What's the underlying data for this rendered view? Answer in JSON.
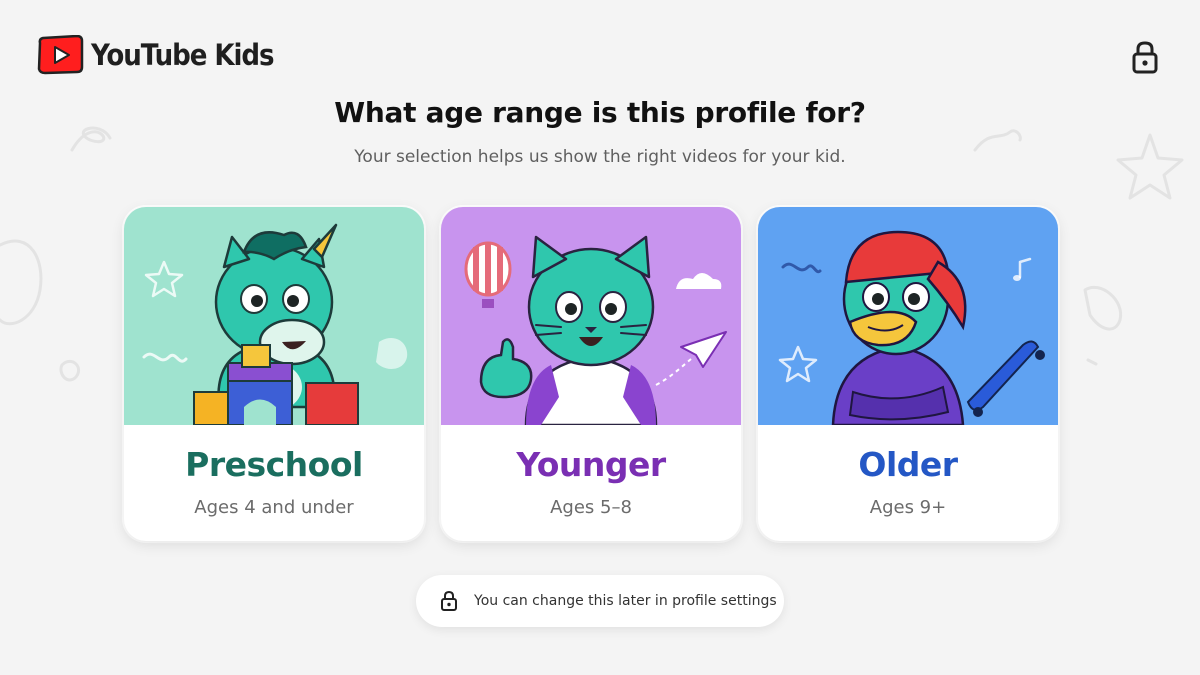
{
  "app": {
    "brand_name": "YouTube Kids",
    "brand_red": "#ff0000"
  },
  "header": {
    "logo_icon": "youtube-play-icon",
    "lock_icon": "lock-icon"
  },
  "main": {
    "title": "What age range is this profile for?",
    "subtitle": "Your selection helps us show the right videos for your kid."
  },
  "age_options": [
    {
      "label": "Preschool",
      "ages": "Ages 4 and under",
      "color": "#1a6e5f",
      "art_background": "#9fe3cf",
      "character": "unicorn-with-blocks"
    },
    {
      "label": "Younger",
      "ages": "Ages 5–8",
      "color": "#7a2fb3",
      "art_background": "#c894ee",
      "character": "cat-thumbs-up"
    },
    {
      "label": "Older",
      "ages": "Ages 9+",
      "color": "#2457c5",
      "art_background": "#5fa2f2",
      "character": "parrot-with-cap"
    }
  ],
  "footer_note": {
    "icon": "lock-icon",
    "text": "You can change this later in profile settings"
  }
}
